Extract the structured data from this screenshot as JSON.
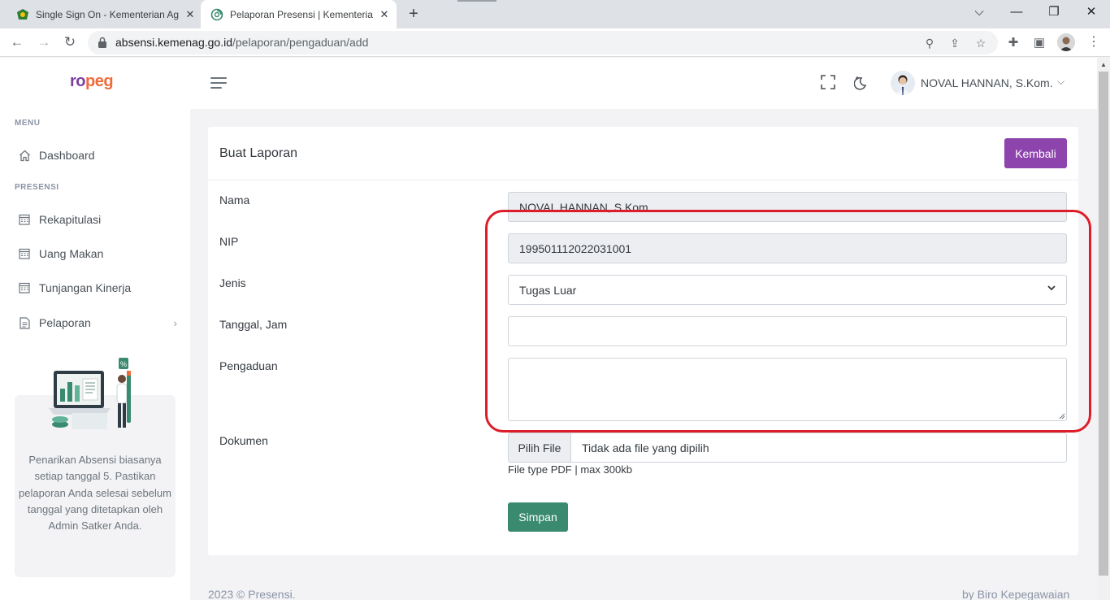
{
  "browser": {
    "tabs": [
      {
        "title": "Single Sign On - Kementerian Agama",
        "icon": "kemenag-logo-icon"
      },
      {
        "title": "Pelaporan Presensi | Kementerian Agama",
        "icon": "spiral-favicon-icon"
      }
    ],
    "url_host": "absensi.kemenag.go.id",
    "url_path": "/pelaporan/pengaduan/add"
  },
  "app": {
    "logo_prefix": "ro",
    "logo_suffix": "peg",
    "user_name": "NOVAL HANNAN, S.Kom."
  },
  "sidebar": {
    "menu_title": "MENU",
    "presensi_title": "PRESENSI",
    "items": [
      {
        "label": "Dashboard",
        "icon": "home-icon"
      },
      {
        "label": "Rekapitulasi",
        "icon": "calendar-icon"
      },
      {
        "label": "Uang Makan",
        "icon": "calendar-icon"
      },
      {
        "label": "Tunjangan Kinerja",
        "icon": "calendar-icon"
      },
      {
        "label": "Pelaporan",
        "icon": "document-icon"
      }
    ],
    "info_text": "Penarikan Absensi biasanya setiap tanggal 5. Pastikan pelaporan Anda selesai sebelum tanggal yang ditetapkan oleh Admin Satker Anda."
  },
  "form": {
    "title": "Buat Laporan",
    "back_label": "Kembali",
    "nama_label": "Nama",
    "nama_value": "NOVAL HANNAN, S.Kom.",
    "nip_label": "NIP",
    "nip_value": "199501112022031001",
    "jenis_label": "Jenis",
    "jenis_value": "Tugas Luar",
    "tanggal_label": "Tanggal, Jam",
    "tanggal_value": "",
    "pengaduan_label": "Pengaduan",
    "pengaduan_value": "",
    "dokumen_label": "Dokumen",
    "file_button": "Pilih File",
    "file_name": "Tidak ada file yang dipilih",
    "file_help": "File type PDF | max 300kb",
    "submit_label": "Simpan"
  },
  "footer": {
    "left": "2023 © Presensi.",
    "right": "by Biro Kepegawaian"
  },
  "colors": {
    "accent_purple": "#8e44ad",
    "submit_green": "#3a8a70",
    "highlight_red": "#dd1e2a",
    "logo_orange": "#f06b3a"
  }
}
